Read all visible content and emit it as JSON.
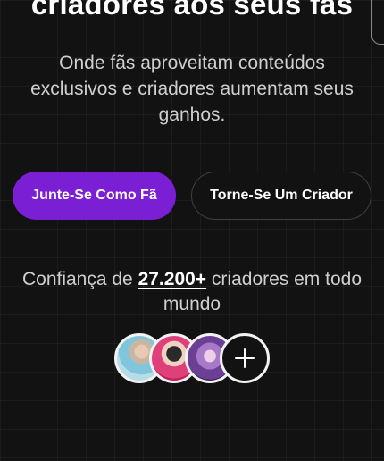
{
  "hero": {
    "headline": "criadores aos seus fãs",
    "subtitle": "Onde fãs aproveitam conteúdos exclusivos e criadores aumentam seus ganhos."
  },
  "actions": {
    "join_fan_label": "Junte-Se Como Fã",
    "become_creator_label": "Torne-Se Um Criador"
  },
  "trust": {
    "prefix": "Confiança de",
    "count": "27.200+",
    "suffix": "criadores em todo mundo"
  },
  "avatars": {
    "items": [
      "creator-avatar-1",
      "creator-avatar-2",
      "creator-avatar-3"
    ],
    "more_icon": "plus-icon"
  },
  "colors": {
    "accent": "#7a1fd3",
    "background": "#121212",
    "muted_text": "#cfcfcf"
  }
}
